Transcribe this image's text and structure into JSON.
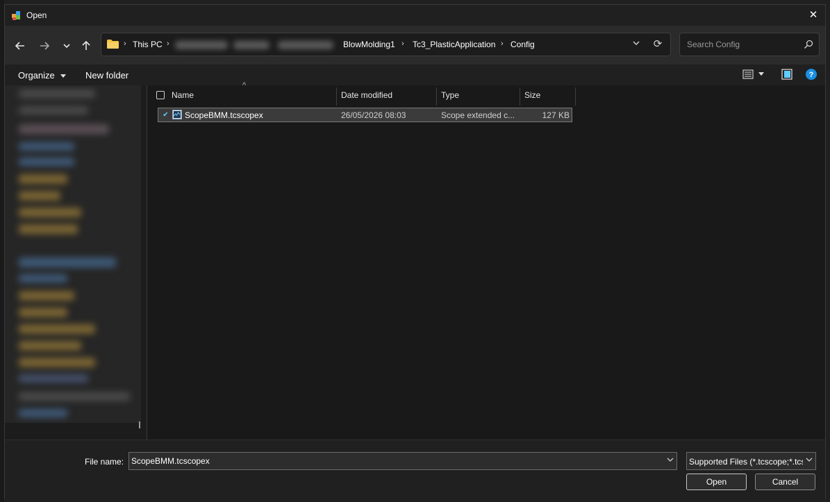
{
  "window": {
    "title": "Open"
  },
  "nav": {
    "back_icon": "arrow-left-icon",
    "forward_icon": "arrow-right-icon",
    "recent_icon": "chevron-down-icon",
    "up_icon": "arrow-up-icon"
  },
  "address": {
    "breadcrumbs": [
      "This PC",
      "BlowMolding1",
      "Tc3_PlasticApplication",
      "Config"
    ]
  },
  "search": {
    "placeholder": "Search Config",
    "value": ""
  },
  "toolbar": {
    "organize_label": "Organize",
    "new_folder_label": "New folder"
  },
  "file_list": {
    "columns": {
      "name": "Name",
      "date": "Date modified",
      "type": "Type",
      "size": "Size"
    },
    "rows": [
      {
        "name": "ScopeBMM.tcscopex",
        "date": "26/05/2026 08:03",
        "type": "Scope extended c...",
        "size": "127 KB",
        "selected": true
      }
    ]
  },
  "bottom": {
    "file_name_label": "File name:",
    "file_name_value": "ScopeBMM.tcscopex",
    "file_type_value": "Supported Files (*.tcscope;*.tcscopex)",
    "open_label": "Open",
    "cancel_label": "Cancel"
  },
  "colors": {
    "background": "#202020",
    "accent": "#60cdff",
    "folder": "#f4c542",
    "help": "#1a8fe3"
  }
}
